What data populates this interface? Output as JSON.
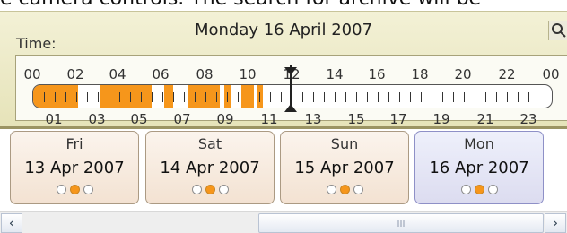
{
  "header_fragment": "e camera controls. The search for archive will be",
  "panel": {
    "date": "Monday 16 April 2007",
    "time_label": "Time:",
    "search_icon": "search-icon",
    "hours_top": [
      "00",
      "02",
      "04",
      "06",
      "08",
      "10",
      "12",
      "14",
      "16",
      "18",
      "20",
      "22",
      "00"
    ],
    "hours_bottom": [
      "01",
      "03",
      "05",
      "07",
      "09",
      "11",
      "13",
      "15",
      "17",
      "19",
      "21",
      "23"
    ],
    "recorded_color": "#f6961b"
  },
  "days": [
    {
      "name": "Fri",
      "date": "13 Apr 2007",
      "selected": false
    },
    {
      "name": "Sat",
      "date": "14 Apr 2007",
      "selected": false
    },
    {
      "name": "Sun",
      "date": "15 Apr 2007",
      "selected": false
    },
    {
      "name": "Mon",
      "date": "16 Apr 2007",
      "selected": true
    }
  ],
  "scrollbar": {
    "left_icon": "chevron-left-icon",
    "right_icon": "chevron-right-icon"
  }
}
